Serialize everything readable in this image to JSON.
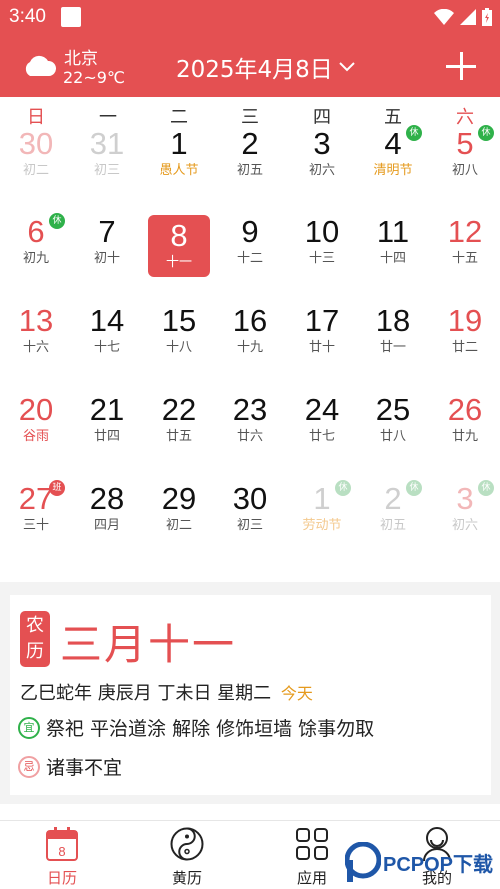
{
  "status_bar": {
    "time": "3:40"
  },
  "header": {
    "city": "北京",
    "temperature": "22~9℃",
    "current_date": "2025年4月8日",
    "weather_icon": "cloud-icon",
    "add_icon": "plus-icon"
  },
  "weekdays": [
    "日",
    "一",
    "二",
    "三",
    "四",
    "五",
    "六"
  ],
  "calendar": {
    "rows": [
      [
        {
          "day": "30",
          "lunar": "初二",
          "style": "faded"
        },
        {
          "day": "31",
          "lunar": "初三",
          "style": "fadedgray"
        },
        {
          "day": "1",
          "lunar": "愚人节",
          "style": "festival"
        },
        {
          "day": "2",
          "lunar": "初五",
          "style": ""
        },
        {
          "day": "3",
          "lunar": "初六",
          "style": ""
        },
        {
          "day": "4",
          "lunar": "清明节",
          "style": "festival",
          "badge": "休",
          "badge_type": "rest"
        },
        {
          "day": "5",
          "lunar": "初八",
          "style": "red",
          "badge": "休",
          "badge_type": "rest"
        }
      ],
      [
        {
          "day": "6",
          "lunar": "初九",
          "style": "red",
          "badge": "休",
          "badge_type": "rest"
        },
        {
          "day": "7",
          "lunar": "初十",
          "style": ""
        },
        {
          "day": "8",
          "lunar": "十一",
          "style": "today"
        },
        {
          "day": "9",
          "lunar": "十二",
          "style": ""
        },
        {
          "day": "10",
          "lunar": "十三",
          "style": ""
        },
        {
          "day": "11",
          "lunar": "十四",
          "style": ""
        },
        {
          "day": "12",
          "lunar": "十五",
          "style": "red"
        }
      ],
      [
        {
          "day": "13",
          "lunar": "十六",
          "style": "red"
        },
        {
          "day": "14",
          "lunar": "十七",
          "style": ""
        },
        {
          "day": "15",
          "lunar": "十八",
          "style": ""
        },
        {
          "day": "16",
          "lunar": "十九",
          "style": ""
        },
        {
          "day": "17",
          "lunar": "廿十",
          "style": ""
        },
        {
          "day": "18",
          "lunar": "廿一",
          "style": ""
        },
        {
          "day": "19",
          "lunar": "廿二",
          "style": "red"
        }
      ],
      [
        {
          "day": "20",
          "lunar": "谷雨",
          "style": "red redlun"
        },
        {
          "day": "21",
          "lunar": "廿四",
          "style": ""
        },
        {
          "day": "22",
          "lunar": "廿五",
          "style": ""
        },
        {
          "day": "23",
          "lunar": "廿六",
          "style": ""
        },
        {
          "day": "24",
          "lunar": "廿七",
          "style": ""
        },
        {
          "day": "25",
          "lunar": "廿八",
          "style": ""
        },
        {
          "day": "26",
          "lunar": "廿九",
          "style": "red"
        }
      ],
      [
        {
          "day": "27",
          "lunar": "三十",
          "style": "red",
          "badge": "班",
          "badge_type": "work"
        },
        {
          "day": "28",
          "lunar": "四月",
          "style": ""
        },
        {
          "day": "29",
          "lunar": "初二",
          "style": ""
        },
        {
          "day": "30",
          "lunar": "初三",
          "style": ""
        },
        {
          "day": "1",
          "lunar": "劳动节",
          "style": "fadedfest",
          "badge": "休",
          "badge_type": "restfade"
        },
        {
          "day": "2",
          "lunar": "初五",
          "style": "fadedgray",
          "badge": "休",
          "badge_type": "restfade"
        },
        {
          "day": "3",
          "lunar": "初六",
          "style": "faded",
          "badge": "休",
          "badge_type": "restfade"
        }
      ]
    ]
  },
  "detail": {
    "lunar_tag": "农历",
    "lunar_date": "三月十一",
    "ganzhi": "乙巳蛇年 庚辰月 丁未日 星期二",
    "today_label": "今天",
    "yi_icon": "宜",
    "yi_text": "祭祀 平治道涂 解除 修饰垣墙 馀事勿取",
    "ji_icon": "忌",
    "ji_text": "诸事不宜"
  },
  "tabs": [
    {
      "label": "日历",
      "icon": "calendar-icon",
      "badge": "8",
      "active": true
    },
    {
      "label": "黄历",
      "icon": "yin-yang-icon"
    },
    {
      "label": "应用",
      "icon": "apps-grid-icon"
    },
    {
      "label": "我的",
      "icon": "profile-icon"
    }
  ],
  "watermark": {
    "text": "PCPOP下载"
  },
  "colors": {
    "primary": "#e45052",
    "festival": "#e59a1d",
    "rest": "#2fb14a"
  }
}
